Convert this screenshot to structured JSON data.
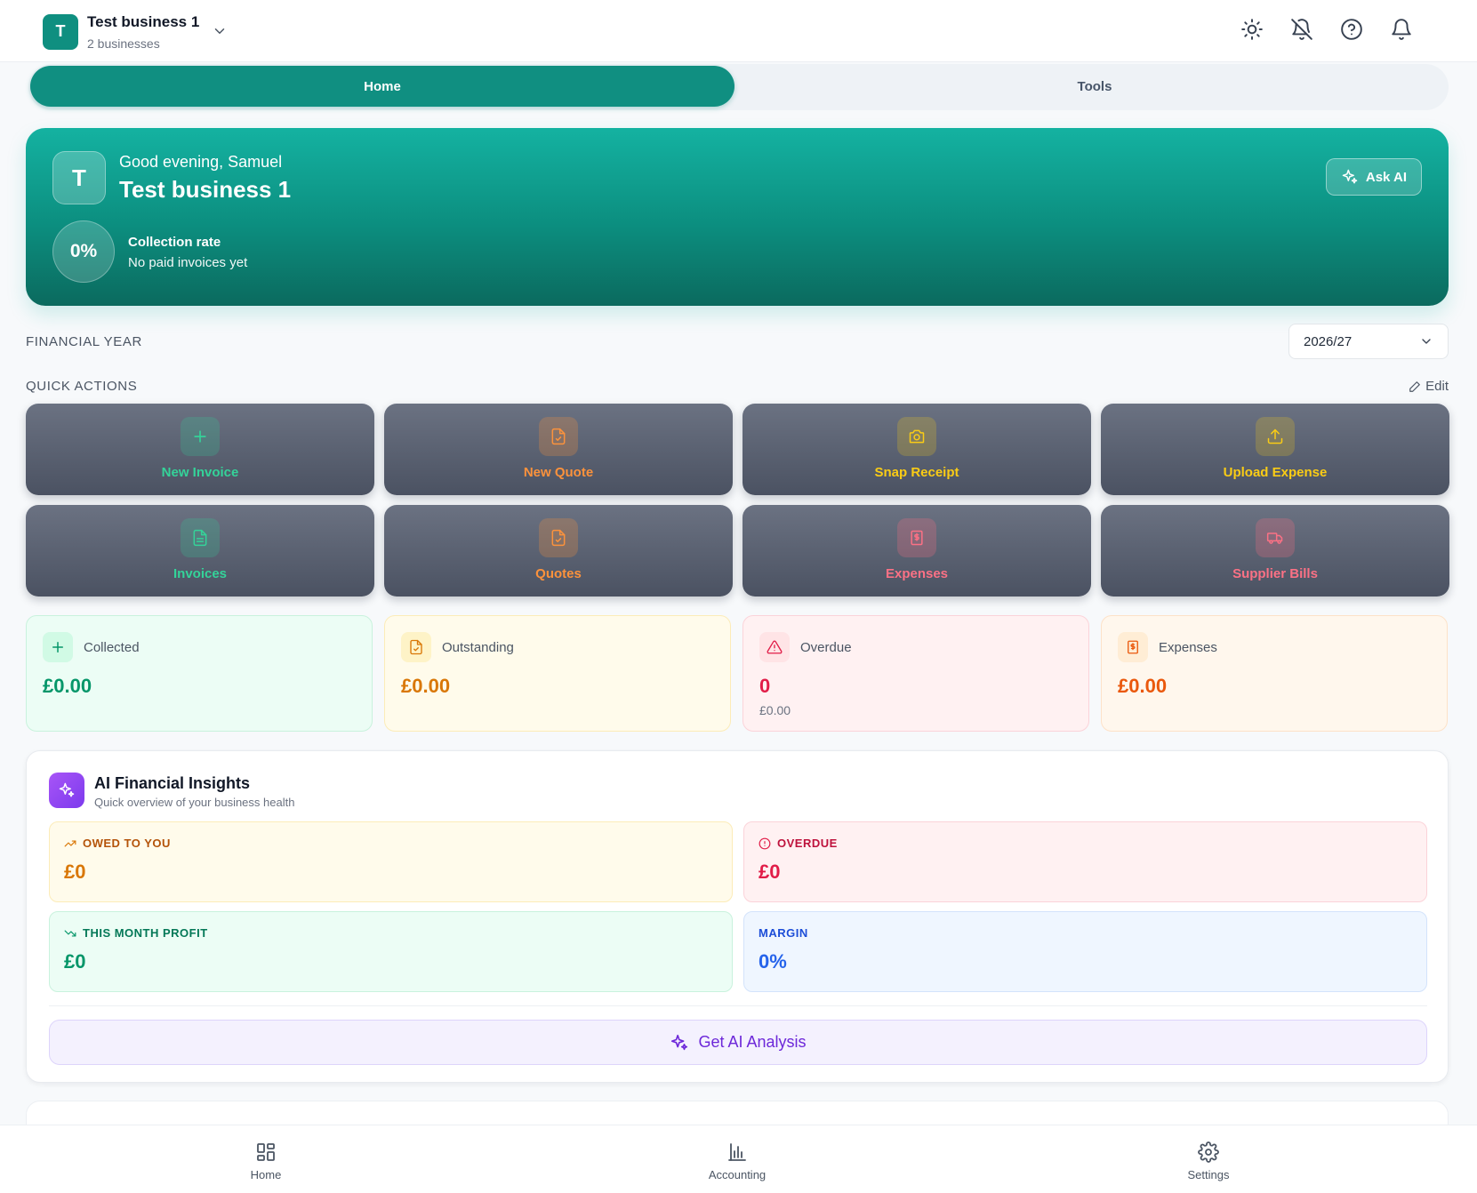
{
  "header": {
    "avatar_letter": "T",
    "business_name": "Test business 1",
    "business_count": "2 businesses",
    "icons": [
      "sun-icon",
      "bell-off-icon",
      "help-icon",
      "bell-icon"
    ]
  },
  "tabs": [
    {
      "label": "Home",
      "active": true
    },
    {
      "label": "Tools",
      "active": false
    }
  ],
  "hero": {
    "avatar_letter": "T",
    "greeting": "Good evening, Samuel",
    "business_name": "Test business 1",
    "ask_ai_label": "Ask AI",
    "collection_rate": "0%",
    "collection_label": "Collection rate",
    "collection_sub": "No paid invoices yet"
  },
  "financial_year": {
    "label": "FINANCIAL YEAR",
    "selected": "2026/27"
  },
  "quick_actions": {
    "label": "QUICK ACTIONS",
    "edit_label": "Edit",
    "items": [
      {
        "label": "New Invoice",
        "icon": "plus-icon",
        "color": "#34d399"
      },
      {
        "label": "New Quote",
        "icon": "file-check-icon",
        "color": "#fb923c"
      },
      {
        "label": "Snap Receipt",
        "icon": "camera-icon",
        "color": "#facc15"
      },
      {
        "label": "Upload Expense",
        "icon": "upload-icon",
        "color": "#facc15"
      },
      {
        "label": "Invoices",
        "icon": "file-text-icon",
        "color": "#34d399"
      },
      {
        "label": "Quotes",
        "icon": "file-check-icon",
        "color": "#fb923c"
      },
      {
        "label": "Expenses",
        "icon": "receipt-icon",
        "color": "#fb7185"
      },
      {
        "label": "Supplier Bills",
        "icon": "truck-icon",
        "color": "#fb7185"
      }
    ]
  },
  "stats": [
    {
      "title": "Collected",
      "value": "£0.00",
      "sub": "",
      "icon": "plus-icon",
      "accent": "#059669"
    },
    {
      "title": "Outstanding",
      "value": "£0.00",
      "sub": "",
      "icon": "file-check-icon",
      "accent": "#d97706"
    },
    {
      "title": "Overdue",
      "value": "0",
      "sub": "£0.00",
      "icon": "alert-triangle-icon",
      "accent": "#e11d48"
    },
    {
      "title": "Expenses",
      "value": "£0.00",
      "sub": "",
      "icon": "receipt-icon",
      "accent": "#ea580c"
    }
  ],
  "ai_insights": {
    "title": "AI Financial Insights",
    "subtitle": "Quick overview of your business health",
    "boxes": [
      {
        "label": "OWED TO YOU",
        "value": "£0",
        "icon": "trending-up-icon"
      },
      {
        "label": "OVERDUE",
        "value": "£0",
        "icon": "alert-circle-icon"
      },
      {
        "label": "THIS MONTH PROFIT",
        "value": "£0",
        "icon": "trending-down-icon"
      },
      {
        "label": "MARGIN",
        "value": "0%",
        "icon": ""
      }
    ],
    "button_label": "Get AI Analysis"
  },
  "bottom_nav": [
    {
      "label": "Home",
      "icon": "grid-icon"
    },
    {
      "label": "Accounting",
      "icon": "bar-chart-icon"
    },
    {
      "label": "Settings",
      "icon": "gear-icon"
    }
  ]
}
